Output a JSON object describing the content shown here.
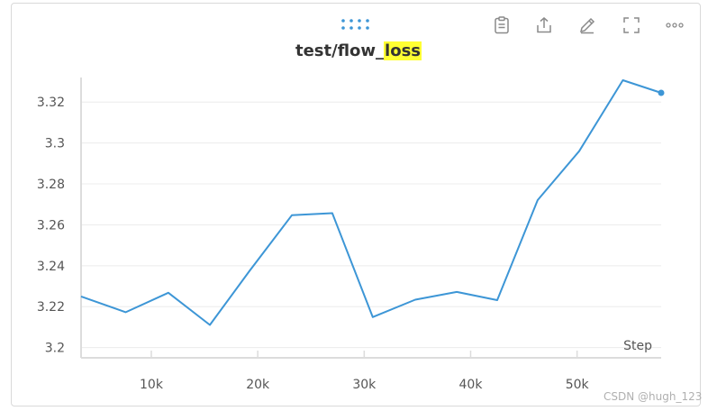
{
  "panel": {
    "title_prefix": "test/flow_",
    "title_highlight": "loss",
    "toolbar": [
      {
        "icon": "clipboard-icon"
      },
      {
        "icon": "share-icon"
      },
      {
        "icon": "edit-icon"
      },
      {
        "icon": "fullscreen-icon"
      },
      {
        "icon": "more-icon"
      }
    ]
  },
  "chart_data": {
    "type": "line",
    "title": "test/flow_loss",
    "xlabel": "Step",
    "ylabel": "",
    "x_ticks": [
      10000,
      20000,
      30000,
      40000,
      50000
    ],
    "x_tick_labels": [
      "10k",
      "20k",
      "30k",
      "40k",
      "50k"
    ],
    "y_ticks": [
      3.2,
      3.22,
      3.24,
      3.26,
      3.28,
      3.3,
      3.32
    ],
    "y_tick_labels": [
      "3.2",
      "3.22",
      "3.24",
      "3.26",
      "3.28",
      "3.3",
      "3.32"
    ],
    "xlim": [
      3400,
      57900
    ],
    "ylim": [
      3.195,
      3.332
    ],
    "grid": true,
    "color": "#3d96d6",
    "series": [
      {
        "x": [
          3400,
          7600,
          11600,
          15500,
          19200,
          23200,
          27000,
          30800,
          34800,
          38700,
          42500,
          46300,
          50200,
          54300,
          57900
        ],
        "y": [
          3.225,
          3.2173,
          3.2268,
          3.2111,
          3.2373,
          3.2647,
          3.2657,
          3.2149,
          3.2234,
          3.2272,
          3.2232,
          3.2721,
          3.296,
          3.3307,
          3.3245
        ]
      }
    ]
  },
  "watermark": "CSDN @hugh_123"
}
